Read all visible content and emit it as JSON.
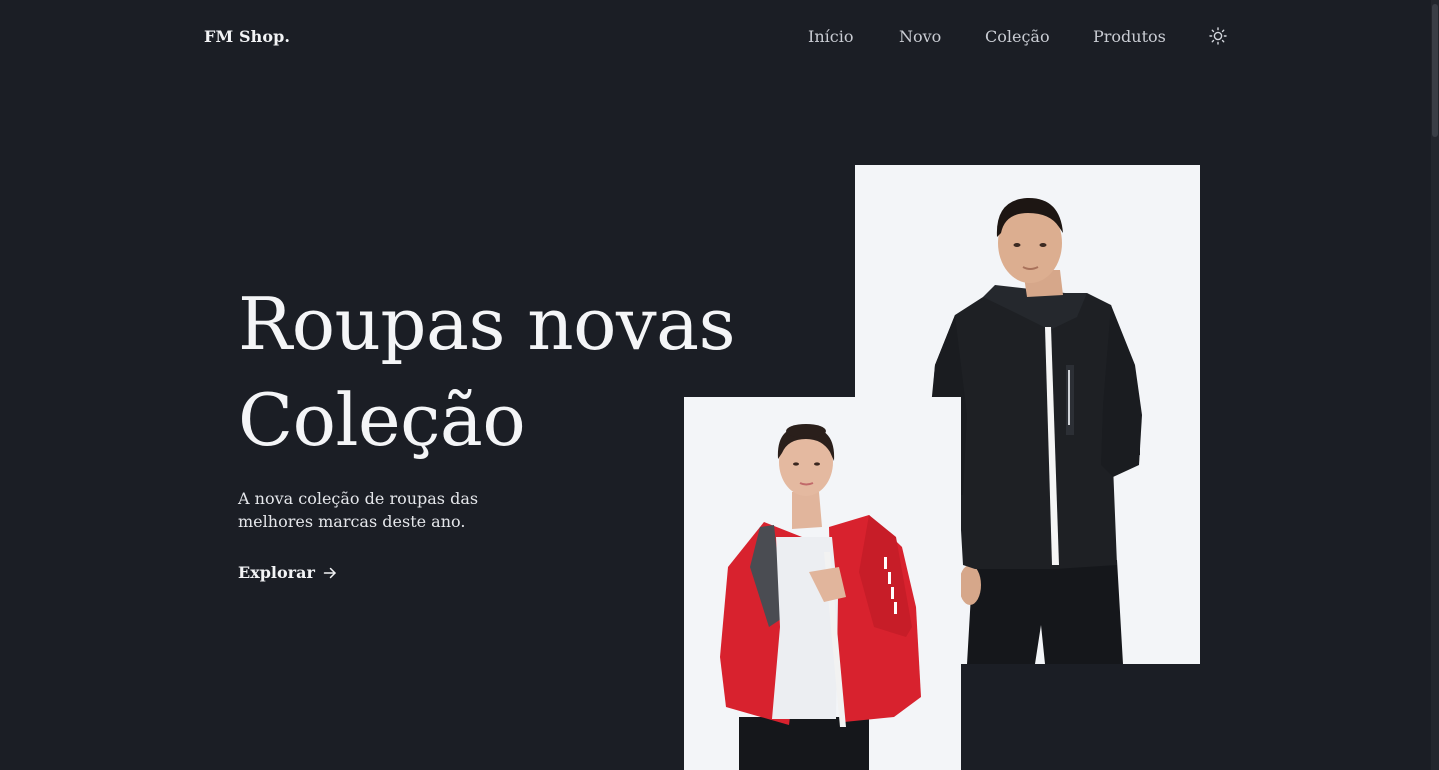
{
  "brand": {
    "name": "FM Shop."
  },
  "nav": {
    "items": [
      {
        "label": "Início"
      },
      {
        "label": "Novo"
      },
      {
        "label": "Coleção"
      },
      {
        "label": "Produtos"
      }
    ],
    "theme_icon": "sun-icon"
  },
  "hero": {
    "title_line1": "Roupas novas",
    "title_line2": "Coleção",
    "description": "A nova coleção de roupas das melhores marcas deste ano.",
    "cta_label": "Explorar",
    "cta_icon": "arrow-right-icon"
  },
  "images": {
    "man": "man in black jacket",
    "woman": "woman in red jacket"
  },
  "colors": {
    "background": "#1b1e25",
    "text": "#e9ebef",
    "nav_text": "#c9ccd3",
    "photo_bg": "#f3f5f8",
    "jacket_red": "#d8222e",
    "jacket_black": "#1e2024"
  }
}
